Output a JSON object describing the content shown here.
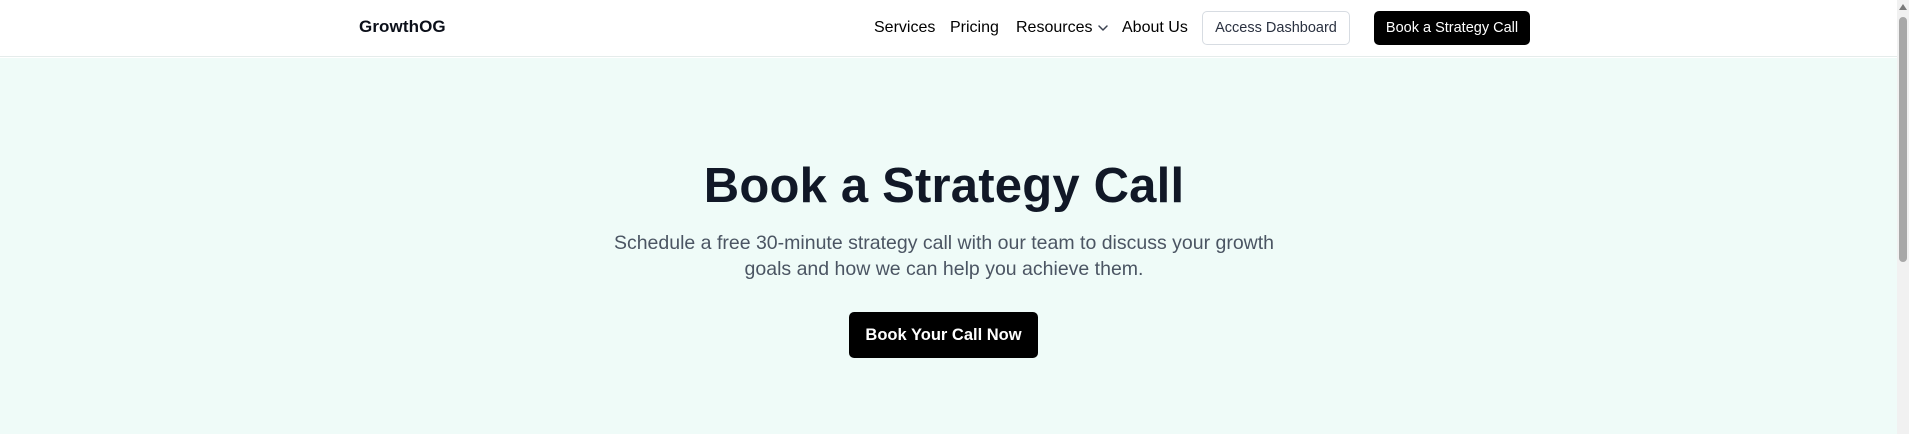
{
  "header": {
    "logo": "GrowthOG",
    "nav": {
      "services": "Services",
      "pricing": "Pricing",
      "resources": "Resources",
      "about": "About Us"
    },
    "dashboard_button": "Access Dashboard",
    "strategy_button": "Book a Strategy Call"
  },
  "hero": {
    "title": "Book a Strategy Call",
    "subtitle": "Schedule a free 30-minute strategy call with our team to discuss your growth goals and how we can help you achieve them.",
    "cta": "Book Your Call Now"
  },
  "colors": {
    "hero_background": "#effbf8",
    "primary_button": "#000000",
    "title": "#111827",
    "body_text": "#4b5563"
  },
  "icons": {
    "resources_dropdown": "chevron-down-icon",
    "scroll_up": "arrow-up-icon"
  }
}
